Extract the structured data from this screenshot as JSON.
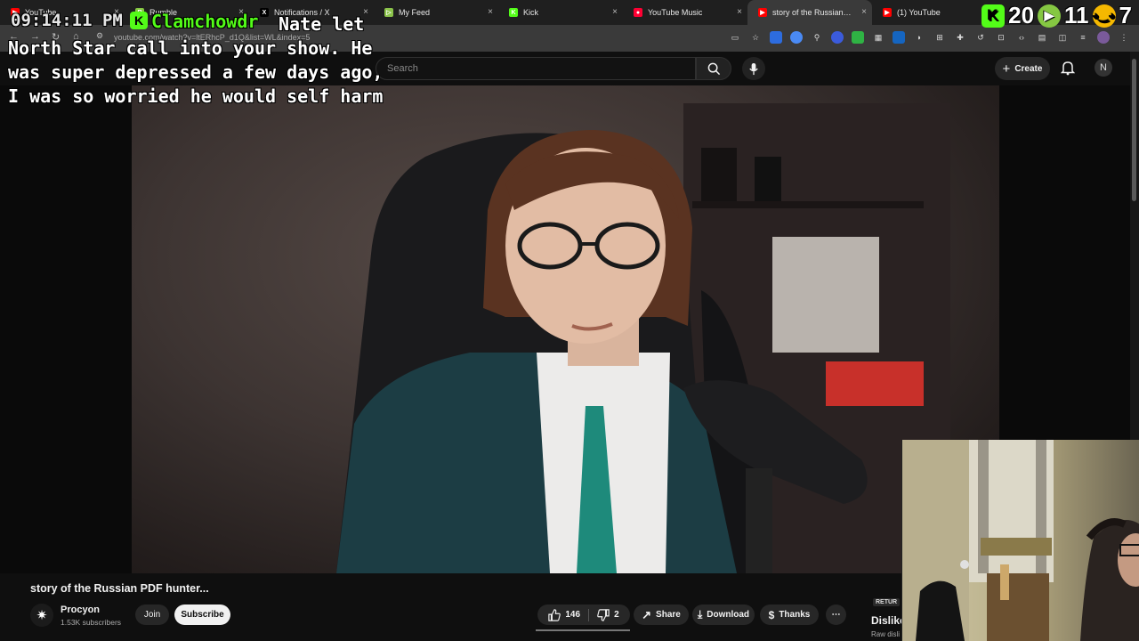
{
  "browser": {
    "tabs": [
      {
        "label": "YouTube",
        "fav_color": "#ff0000",
        "fav_glyph": "▶",
        "active": false
      },
      {
        "label": "Rumble",
        "fav_color": "#85c742",
        "fav_glyph": "R",
        "active": false
      },
      {
        "label": "Notifications / X",
        "fav_color": "#000000",
        "fav_glyph": "X",
        "active": false
      },
      {
        "label": "My Feed",
        "fav_color": "#8bc34a",
        "fav_glyph": "▷",
        "active": false
      },
      {
        "label": "Kick",
        "fav_color": "#53fc18",
        "fav_glyph": "K",
        "active": false
      },
      {
        "label": "YouTube Music",
        "fav_color": "#ff0033",
        "fav_glyph": "●",
        "active": false
      },
      {
        "label": "story of the Russian PDF",
        "fav_color": "#ff0000",
        "fav_glyph": "▶",
        "active": true
      },
      {
        "label": "(1) YouTube",
        "fav_color": "#ff0000",
        "fav_glyph": "▶",
        "active": false
      }
    ],
    "url": "youtube.com/watch?v=ltERhcP_d1Q&list=WL&index=5"
  },
  "overlay": {
    "clock": "09:14:11 PM",
    "chat_user": "Clamchowdr",
    "chat_message": "Nate let North Star call into your show. He was super depressed a few days ago, I was so worried he would self harm",
    "counter_a": "20",
    "counter_b": "11",
    "counter_c": "7"
  },
  "youtube": {
    "search_placeholder": "Search",
    "create_label": "Create",
    "avatar_letter": "N",
    "video_title": "story of the Russian PDF hunter...",
    "channel_name": "Procyon",
    "subscribers": "1.53K subscribers",
    "join_label": "Join",
    "subscribe_label": "Subscribe",
    "likes": "146",
    "dislikes": "2",
    "share_label": "Share",
    "download_label": "Download",
    "thanks_label": "Thanks",
    "side_badge": "RETUR",
    "side_title": "Dislike",
    "side_sub": "Raw disli"
  },
  "colors": {
    "kick_green": "#53fc18",
    "youtube_red": "#ff0000"
  }
}
